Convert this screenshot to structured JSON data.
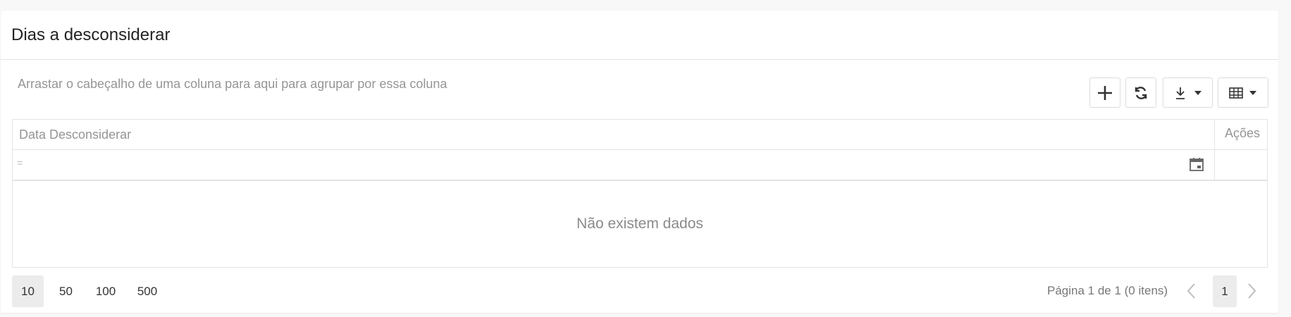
{
  "panel": {
    "title": "Dias a desconsiderar"
  },
  "toolbar": {
    "group_hint": "Arrastar o cabeçalho de uma coluna para aqui para agrupar por essa coluna",
    "add_icon": "plus-icon",
    "refresh_icon": "refresh-icon",
    "export_icon": "download-icon",
    "columns_icon": "table-icon"
  },
  "grid": {
    "columns": [
      {
        "label": "Data Desconsiderar"
      },
      {
        "label": "Ações"
      }
    ],
    "filter_operator": "=",
    "empty_text": "Não existem dados"
  },
  "pager": {
    "sizes": [
      "10",
      "50",
      "100",
      "500"
    ],
    "selected_size": "10",
    "info": "Página 1 de 1 (0 itens)",
    "current_page": "1"
  },
  "colors": {
    "border": "#e4e4e4",
    "muted_text": "#959595",
    "active_bg": "#ececec"
  }
}
